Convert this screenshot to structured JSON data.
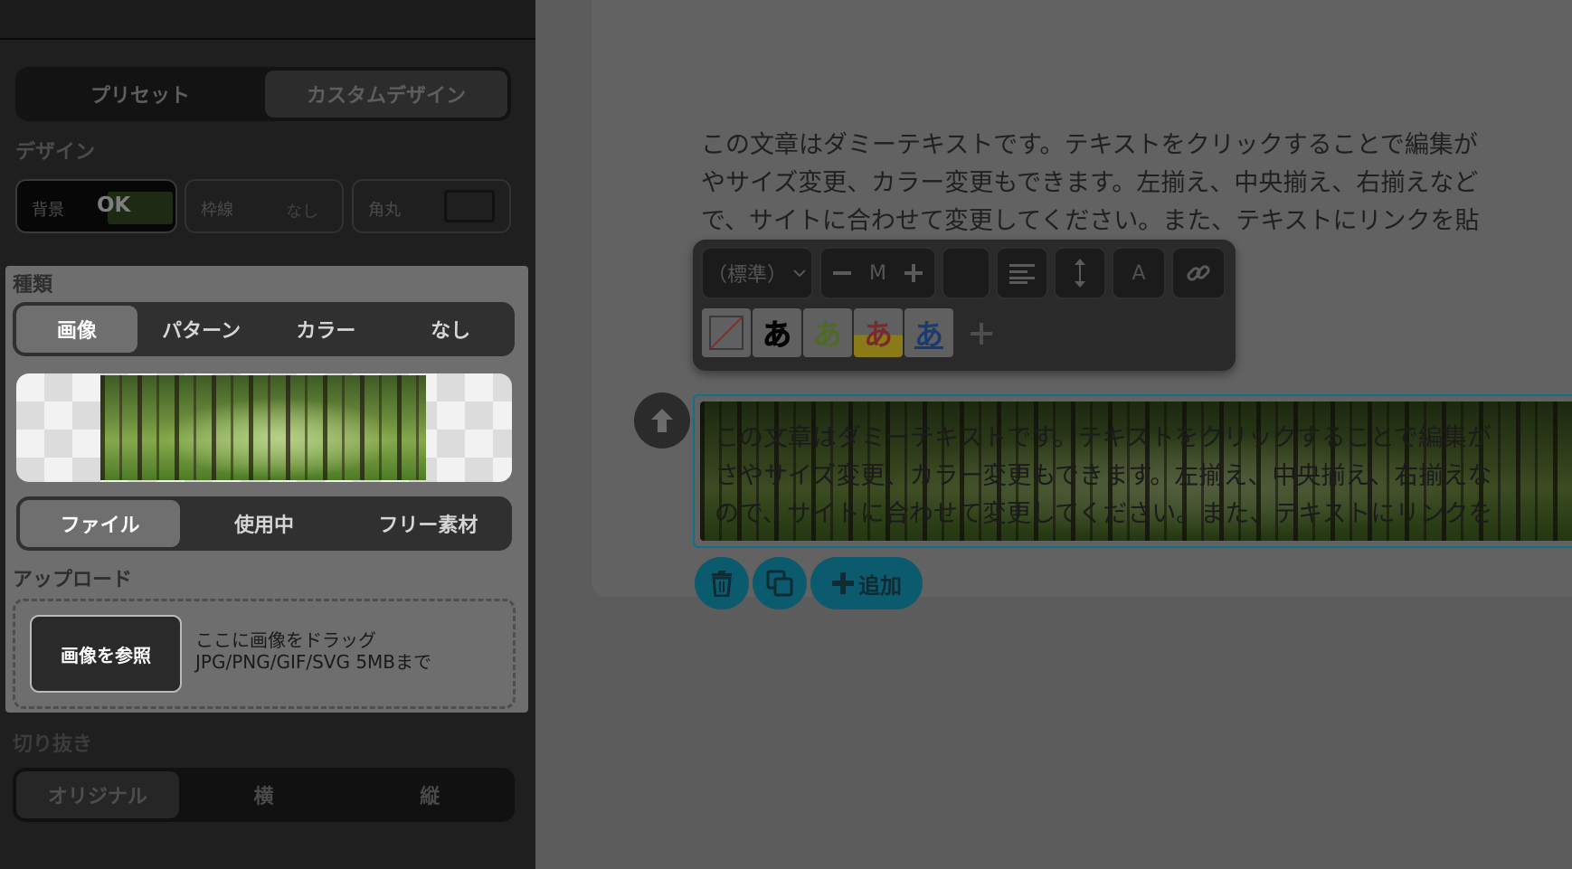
{
  "sidebar": {
    "mode_tabs": [
      {
        "label": "プリセット",
        "active": false
      },
      {
        "label": "カスタムデザイン",
        "active": true
      }
    ],
    "design_label": "デザイン",
    "design_buttons": {
      "background": {
        "label": "背景",
        "value": "OK"
      },
      "border": {
        "label": "枠線",
        "value": "なし"
      },
      "radius": {
        "label": "角丸"
      }
    },
    "kind_label": "種類",
    "kind_tabs": [
      {
        "label": "画像",
        "active": true
      },
      {
        "label": "パターン",
        "active": false
      },
      {
        "label": "カラー",
        "active": false
      },
      {
        "label": "なし",
        "active": false
      }
    ],
    "source_tabs": [
      {
        "label": "ファイル",
        "active": true
      },
      {
        "label": "使用中",
        "active": false
      },
      {
        "label": "フリー素材",
        "active": false
      }
    ],
    "upload_label": "アップロード",
    "browse_button": "画像を参照",
    "drop_hint_1": "ここに画像をドラッグ",
    "drop_hint_2": "JPG/PNG/GIF/SVG 5MBまで",
    "crop_label": "切り抜き",
    "crop_tabs": [
      {
        "label": "オリジナル",
        "active": true
      },
      {
        "label": "横",
        "active": false
      },
      {
        "label": "縦",
        "active": false
      }
    ]
  },
  "editor": {
    "text_lines": [
      "この文章はダミーテキストです。テキストをクリックすることで編集が",
      "やサイズ変更、カラー変更もできます。左揃え、中央揃え、右揃えなど",
      "で、サイトに合わせて変更してください。また、テキストにリンクを貼"
    ],
    "toolbar": {
      "font_select": "（標準）",
      "size_value": "M",
      "color_button": "A",
      "swatch_glyph": "あ"
    },
    "block_lines": [
      "この文章はダミーテキストです。テキストをクリックすることで編集が",
      "さやサイズ変更、カラー変更もできます。左揃え、中央揃え、右揃えな",
      "ので、サイトに合わせて変更してください。また、テキストにリンクを"
    ],
    "add_button": "追加"
  },
  "colors": {
    "accent": "#126f88",
    "sidebar_bg": "#1f1f1f",
    "panel_bg": "#6e6e6e"
  },
  "icons": [
    "chevron-down-icon",
    "minus-icon",
    "plus-icon",
    "align-left-icon",
    "line-height-icon",
    "link-icon",
    "arrow-up-icon",
    "trash-icon",
    "copy-icon"
  ]
}
